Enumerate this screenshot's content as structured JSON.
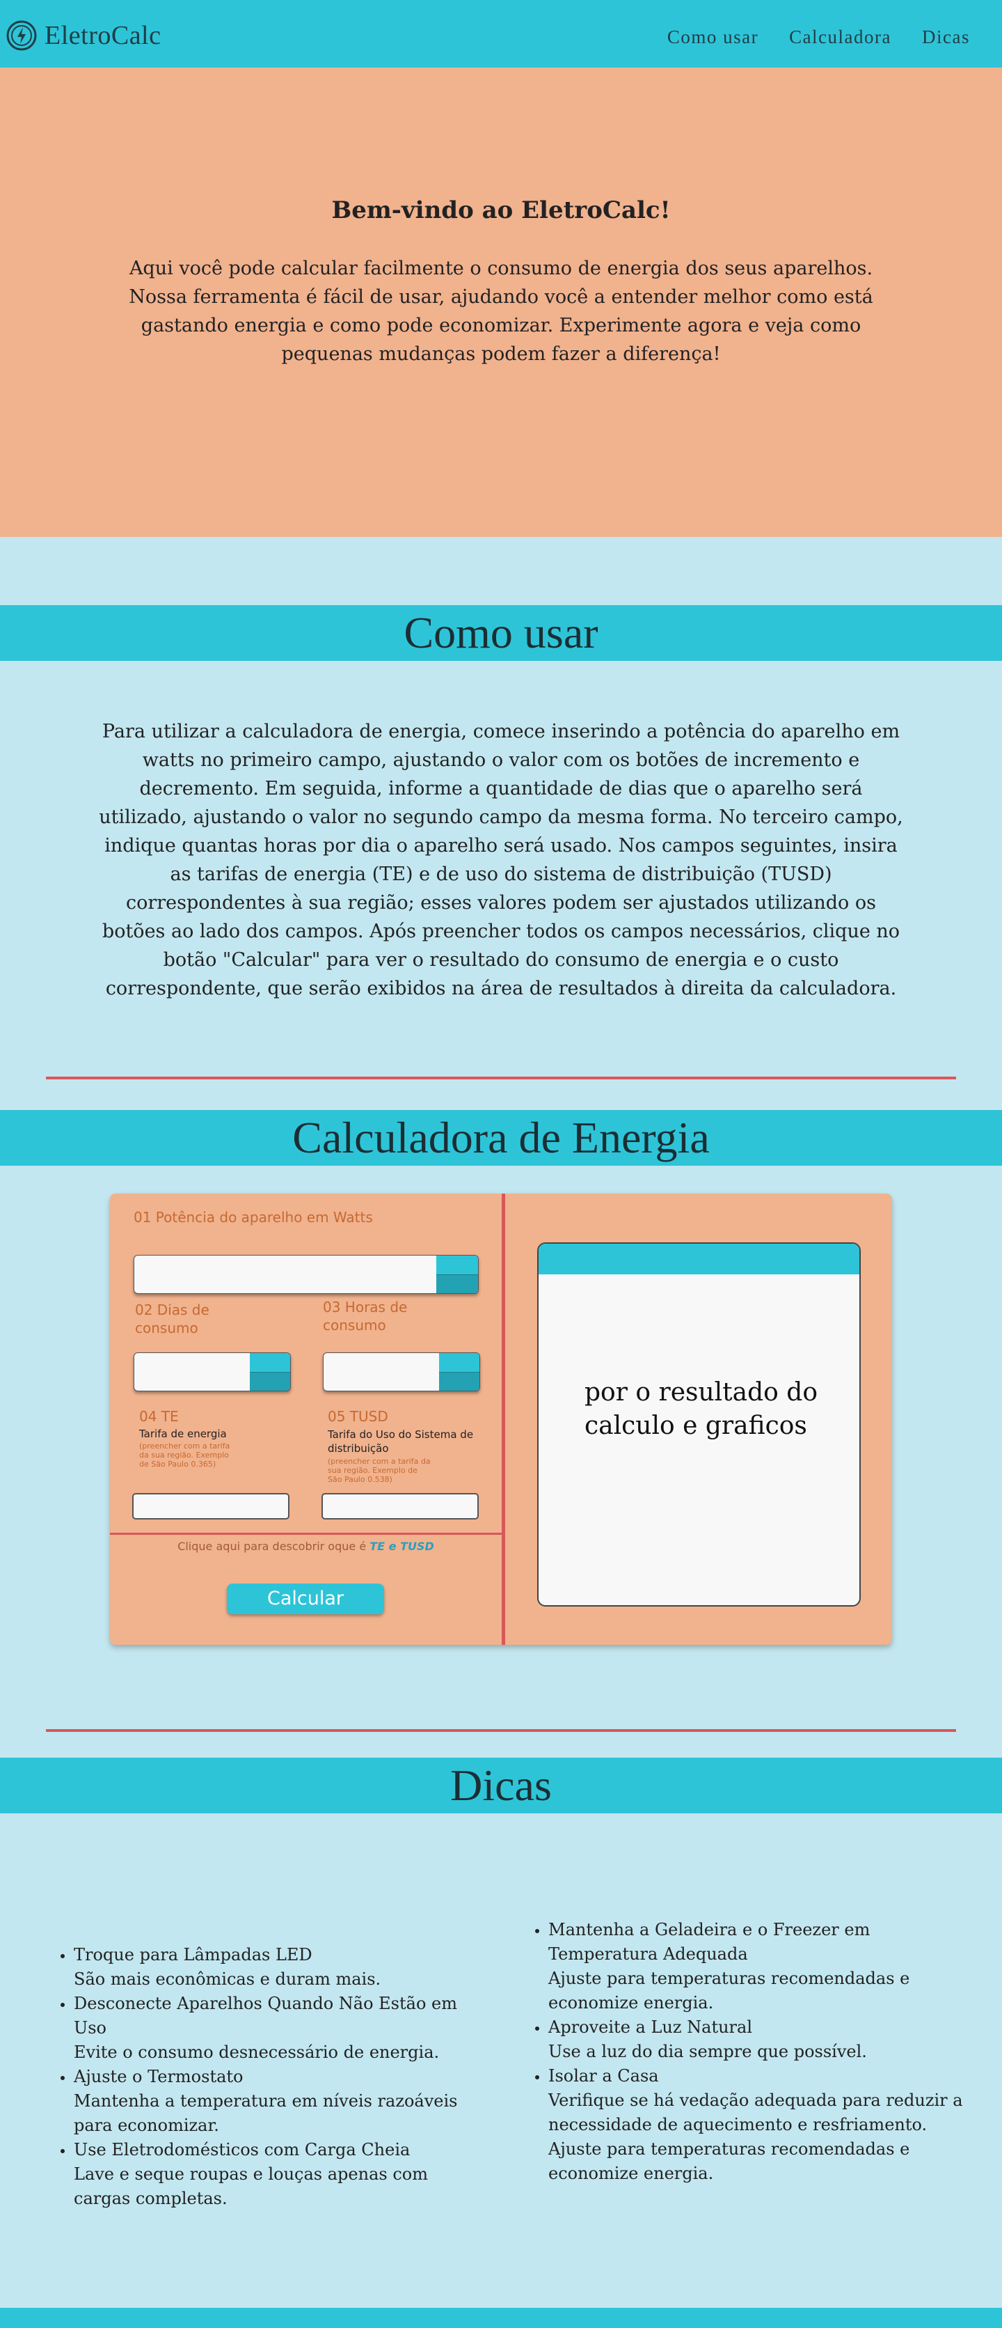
{
  "colors": {
    "nav_bg": "#2ec4d8",
    "hero_bg": "#f1b28e",
    "page_bg": "#c3e7f0",
    "divider": "#d8585a",
    "label_orange": "#c56a31"
  },
  "nav": {
    "logo_icon": "lightning-circle-icon",
    "logo_text": "EletroCalc",
    "links": [
      "Como usar",
      "Calculadora",
      "Dicas"
    ]
  },
  "hero": {
    "title": "Bem-vindo ao EletroCalc!",
    "text": "Aqui você pode calcular facilmente o consumo de energia dos seus aparelhos. Nossa ferramenta é fácil de usar, ajudando você a entender melhor como está gastando energia e como pode economizar. Experimente agora e veja como pequenas mudanças podem fazer a diferença!"
  },
  "howto": {
    "heading": "Como usar",
    "text": "Para utilizar a calculadora de energia, comece inserindo a potência do aparelho em watts no primeiro campo, ajustando o valor com os botões de incremento e decremento. Em seguida, informe a quantidade de dias que o aparelho será utilizado, ajustando o valor no segundo campo da mesma forma. No terceiro campo, indique quantas horas por dia o aparelho será usado. Nos campos seguintes, insira as tarifas de energia (TE) e de uso do sistema de distribuição (TUSD) correspondentes à sua região; esses valores podem ser ajustados utilizando os botões ao lado dos campos. Após preencher todos os campos necessários, clique no botão \"Calcular\" para ver o resultado do consumo de energia e o custo correspondente, que serão exibidos na área de resultados à direita da calculadora."
  },
  "calculator": {
    "heading": "Calculadora de Energia",
    "field1_label": "01 Potência do aparelho em Watts",
    "field2_label": "02 Dias de consumo",
    "field3_label": "03 Horas de consumo",
    "field4_label": "04 TE",
    "field4_sublabel": "Tarifa de energia",
    "field4_note": "(preencher com a tarifa da sua região. Exemplo de São Paulo 0.365)",
    "field5_label": "05 TUSD",
    "field5_sublabel": "Tarifa do Uso do Sistema de distribuição",
    "field5_note": "(preencher com a tarifa da sua região. Exemplo de São Paulo 0.538)",
    "info_text": "Clique aqui para descobrir oque é ",
    "info_link": "TE e TUSD",
    "button": "Calcular",
    "result_placeholder": "por o resultado do calculo e graficos"
  },
  "tips": {
    "heading": "Dicas",
    "left": [
      {
        "title": "Troque para Lâmpadas LED",
        "desc": "São mais econômicas e duram mais."
      },
      {
        "title": "Desconecte Aparelhos Quando Não Estão em Uso",
        "desc": "Evite o consumo desnecessário de energia."
      },
      {
        "title": "Ajuste o Termostato",
        "desc": "Mantenha a temperatura em níveis razoáveis para economizar."
      },
      {
        "title": "Use Eletrodomésticos com Carga Cheia",
        "desc": "Lave e seque roupas e louças apenas com cargas completas."
      }
    ],
    "right": [
      {
        "title": "Mantenha a Geladeira e o Freezer em Temperatura Adequada",
        "desc": "Ajuste para temperaturas recomendadas e economize energia."
      },
      {
        "title": "Aproveite a Luz Natural",
        "desc": "Use a luz do dia sempre que possível."
      },
      {
        "title": "Isolar a Casa",
        "desc": "Verifique se há vedação adequada para reduzir a necessidade de aquecimento e resfriamento. Ajuste para temperaturas recomendadas e economize energia."
      }
    ]
  }
}
